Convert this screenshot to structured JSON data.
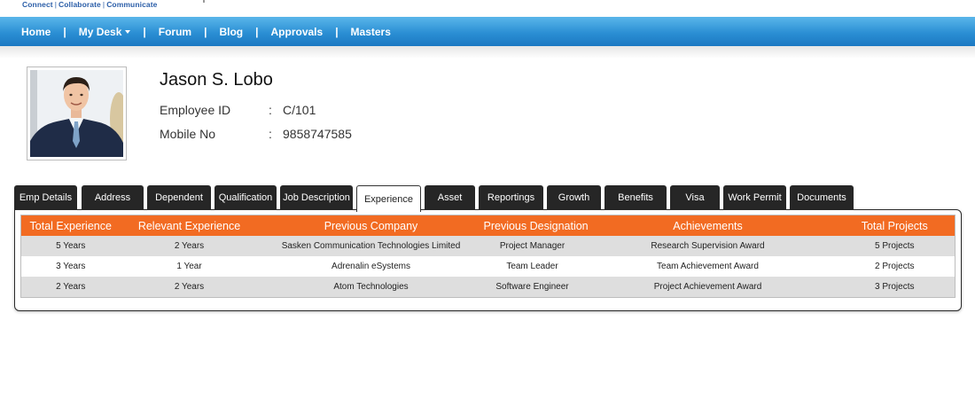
{
  "brand": {
    "tagline_parts": [
      "Connect",
      "Collaborate",
      "Communicate"
    ],
    "separator": "|"
  },
  "nav": {
    "items": [
      "Home",
      "My Desk",
      "Forum",
      "Blog",
      "Approvals",
      "Masters"
    ],
    "separator": "|"
  },
  "employee": {
    "name": "Jason S. Lobo",
    "fields": [
      {
        "label": "Employee ID",
        "colon": ":",
        "value": "C/101"
      },
      {
        "label": "Mobile No",
        "colon": ":",
        "value": "9858747585"
      }
    ]
  },
  "tabs": {
    "items": [
      "Emp Details",
      "Address",
      "Dependent",
      "Qualification",
      "Job Description",
      "Experience",
      "Asset",
      "Reportings",
      "Growth",
      "Benefits",
      "Visa",
      "Work Permit",
      "Documents"
    ],
    "active": "Experience"
  },
  "experience_table": {
    "headers": [
      "Total Experience",
      "Relevant Experience",
      "Previous Company",
      "Previous Designation",
      "Achievements",
      "Total Projects"
    ],
    "rows": [
      [
        "5 Years",
        "2 Years",
        "Sasken Communication Technologies Limited",
        "Project Manager",
        "Research Supervision Award",
        "5 Projects"
      ],
      [
        "3 Years",
        "1 Year",
        "Adrenalin eSystems",
        "Team Leader",
        "Team Achievement Award",
        "2 Projects"
      ],
      [
        "2 Years",
        "2 Years",
        "Atom Technologies",
        "Software Engineer",
        "Project Achievement Award",
        "3 Projects"
      ]
    ]
  },
  "colors": {
    "nav_blue": "#2b8fd4",
    "header_orange": "#f26b22",
    "tab_dark": "#262626",
    "row_gray": "#dedede"
  },
  "icons": {
    "nav_dropdown": "caret-down-icon",
    "profile_photo": "employee-photo"
  }
}
